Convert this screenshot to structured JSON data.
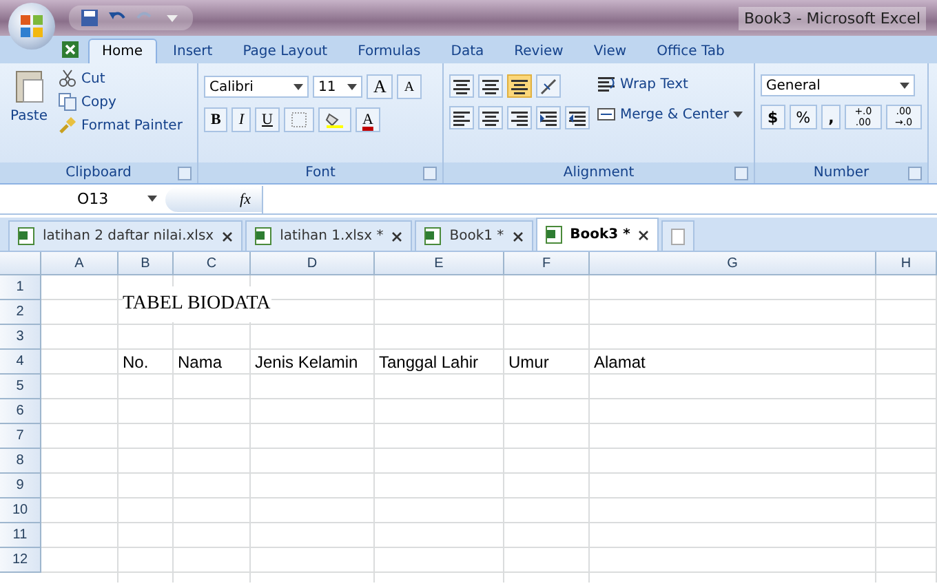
{
  "window": {
    "title": "Book3 - Microsoft Excel"
  },
  "ribbon_tabs": [
    {
      "label": "Home",
      "selected": true
    },
    {
      "label": "Insert",
      "selected": false
    },
    {
      "label": "Page Layout",
      "selected": false
    },
    {
      "label": "Formulas",
      "selected": false
    },
    {
      "label": "Data",
      "selected": false
    },
    {
      "label": "Review",
      "selected": false
    },
    {
      "label": "View",
      "selected": false
    },
    {
      "label": "Office Tab",
      "selected": false
    }
  ],
  "clipboard": {
    "paste": "Paste",
    "cut": "Cut",
    "copy": "Copy",
    "format_painter": "Format Painter",
    "label": "Clipboard"
  },
  "font": {
    "name": "Calibri",
    "size": "11",
    "grow": "A",
    "shrink": "A",
    "bold": "B",
    "italic": "I",
    "underline": "U",
    "font_color_label": "A",
    "label": "Font"
  },
  "alignment": {
    "wrap_text": "Wrap Text",
    "merge_center": "Merge & Center",
    "label": "Alignment"
  },
  "number": {
    "format": "General",
    "currency": "$",
    "percent": "%",
    "comma": ",",
    "increase_decimal": "+.0 .00",
    "decrease_decimal": ".00 →.0",
    "label": "Number"
  },
  "formula_bar": {
    "name_box": "O13",
    "fx": "fx"
  },
  "doc_tabs": [
    {
      "label": "latihan 2 daftar nilai.xlsx",
      "selected": false
    },
    {
      "label": "latihan 1.xlsx *",
      "selected": false
    },
    {
      "label": "Book1 *",
      "selected": false
    },
    {
      "label": "Book3 *",
      "selected": true
    }
  ],
  "columns": [
    "A",
    "B",
    "C",
    "D",
    "E",
    "F",
    "G",
    "H"
  ],
  "rows": [
    {
      "header": "1",
      "cells": {}
    },
    {
      "header": "2",
      "cells": {
        "B": {
          "text": "TABEL BIODATA",
          "kind": "title"
        }
      }
    },
    {
      "header": "3",
      "cells": {}
    },
    {
      "header": "4",
      "cells": {
        "B": {
          "text": "No.",
          "kind": "plain"
        },
        "C": {
          "text": "Nama",
          "kind": "plain"
        },
        "D": {
          "text": "Jenis Kelamin",
          "kind": "plain"
        },
        "E": {
          "text": "Tanggal Lahir",
          "kind": "plain"
        },
        "F": {
          "text": "Umur",
          "kind": "plain"
        },
        "G": {
          "text": "Alamat",
          "kind": "plain"
        }
      }
    },
    {
      "header": "5",
      "cells": {}
    },
    {
      "header": "6",
      "cells": {}
    },
    {
      "header": "7",
      "cells": {}
    },
    {
      "header": "8",
      "cells": {}
    },
    {
      "header": "9",
      "cells": {}
    },
    {
      "header": "10",
      "cells": {}
    },
    {
      "header": "11",
      "cells": {}
    },
    {
      "header": "12",
      "cells": {}
    }
  ]
}
